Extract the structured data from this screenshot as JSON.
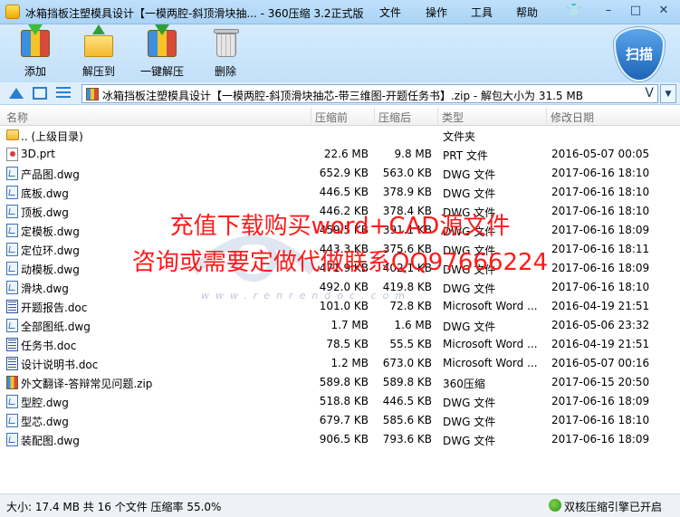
{
  "window": {
    "title": "冰箱挡板注塑模具设计【一模两腔-斜顶滑块抽... - 360压缩 3.2正式版",
    "menu": [
      "文件",
      "操作",
      "工具",
      "帮助"
    ],
    "controls": [
      "minimize",
      "maximize",
      "close"
    ]
  },
  "toolbar": {
    "buttons": [
      {
        "label": "添加",
        "icon": "add-to-archive-icon"
      },
      {
        "label": "解压到",
        "icon": "extract-to-icon"
      },
      {
        "label": "一键解压",
        "icon": "one-click-extract-icon"
      },
      {
        "label": "删除",
        "icon": "delete-trash-icon"
      }
    ],
    "scan_label": "扫描"
  },
  "address": {
    "path": "冰箱挡板注塑模具设计【一模两腔-斜顶滑块抽芯-带三维图-开题任务书】.zip - 解包大小为 31.5 MB",
    "right_glyph": "V"
  },
  "columns": {
    "name": "名称",
    "size_before": "压缩前",
    "size_after": "压缩后",
    "type": "类型",
    "modified": "修改日期"
  },
  "files": [
    {
      "name": ".. (上级目录)",
      "before": "",
      "after": "",
      "type": "文件夹",
      "date": "",
      "icon": "folder"
    },
    {
      "name": "3D.prt",
      "before": "22.6 MB",
      "after": "9.8 MB",
      "type": "PRT 文件",
      "date": "2016-05-07 00:05",
      "icon": "prt"
    },
    {
      "name": "产品图.dwg",
      "before": "652.9 KB",
      "after": "563.0 KB",
      "type": "DWG 文件",
      "date": "2017-06-16 18:10",
      "icon": "dwg"
    },
    {
      "name": "底板.dwg",
      "before": "446.5 KB",
      "after": "378.9 KB",
      "type": "DWG 文件",
      "date": "2017-06-16 18:10",
      "icon": "dwg"
    },
    {
      "name": "顶板.dwg",
      "before": "446.2 KB",
      "after": "378.4 KB",
      "type": "DWG 文件",
      "date": "2017-06-16 18:10",
      "icon": "dwg"
    },
    {
      "name": "定模板.dwg",
      "before": "459.5 KB",
      "after": "391.1 KB",
      "type": "DWG 文件",
      "date": "2017-06-16 18:09",
      "icon": "dwg"
    },
    {
      "name": "定位环.dwg",
      "before": "443.3 KB",
      "after": "375.6 KB",
      "type": "DWG 文件",
      "date": "2017-06-16 18:11",
      "icon": "dwg"
    },
    {
      "name": "动模板.dwg",
      "before": "471.9 KB",
      "after": "402.1 KB",
      "type": "DWG 文件",
      "date": "2017-06-16 18:09",
      "icon": "dwg"
    },
    {
      "name": "滑块.dwg",
      "before": "492.0 KB",
      "after": "419.8 KB",
      "type": "DWG 文件",
      "date": "2017-06-16 18:10",
      "icon": "dwg"
    },
    {
      "name": "开题报告.doc",
      "before": "101.0 KB",
      "after": "72.8 KB",
      "type": "Microsoft Word ...",
      "date": "2016-04-19 21:51",
      "icon": "doc"
    },
    {
      "name": "全部图纸.dwg",
      "before": "1.7 MB",
      "after": "1.6 MB",
      "type": "DWG 文件",
      "date": "2016-05-06 23:32",
      "icon": "dwg"
    },
    {
      "name": "任务书.doc",
      "before": "78.5 KB",
      "after": "55.5 KB",
      "type": "Microsoft Word ...",
      "date": "2016-04-19 21:51",
      "icon": "doc"
    },
    {
      "name": "设计说明书.doc",
      "before": "1.2 MB",
      "after": "673.0 KB",
      "type": "Microsoft Word ...",
      "date": "2016-05-07 00:16",
      "icon": "doc"
    },
    {
      "name": "外文翻译-答辩常见问题.zip",
      "before": "589.8 KB",
      "after": "589.8 KB",
      "type": "360压缩",
      "date": "2017-06-15 20:50",
      "icon": "zip"
    },
    {
      "name": "型腔.dwg",
      "before": "518.8 KB",
      "after": "446.5 KB",
      "type": "DWG 文件",
      "date": "2017-06-16 18:09",
      "icon": "dwg"
    },
    {
      "name": "型芯.dwg",
      "before": "679.7 KB",
      "after": "585.6 KB",
      "type": "DWG 文件",
      "date": "2017-06-16 18:10",
      "icon": "dwg"
    },
    {
      "name": "装配图.dwg",
      "before": "906.5 KB",
      "after": "793.6 KB",
      "type": "DWG 文件",
      "date": "2017-06-16 18:09",
      "icon": "dwg"
    }
  ],
  "overlay": {
    "line1": "充值下载购买word+CAD源文件",
    "line2": "咨询或需要定做代做联系QQ97666224",
    "watermark": "www.renrendoc.com"
  },
  "status": {
    "summary": "大小: 17.4 MB 共 16 个文件 压缩率 55.0%",
    "engine": "双核压缩引擎已开启"
  }
}
